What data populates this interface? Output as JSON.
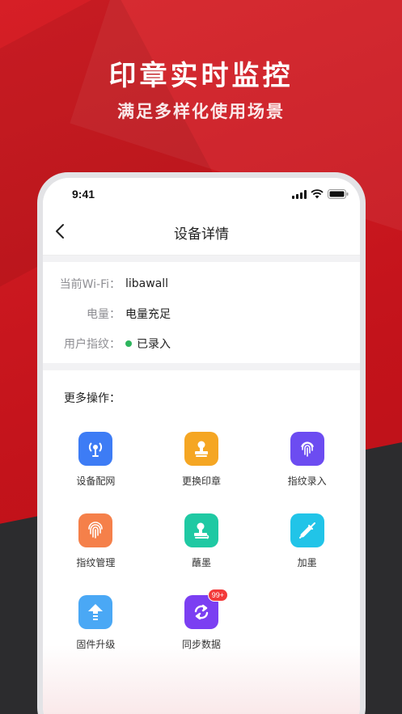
{
  "promo": {
    "headline": "印章实时监控",
    "subline": "满足多样化使用场景"
  },
  "statusbar": {
    "time": "9:41",
    "icons": [
      "signal-icon",
      "wifi-icon",
      "battery-icon"
    ]
  },
  "navbar": {
    "back_icon": "chevron-left-icon",
    "title": "设备详情"
  },
  "info": {
    "rows": [
      {
        "label": "当前Wi-Fi：",
        "value": "libawall"
      },
      {
        "label": "电量：",
        "value": "电量充足"
      },
      {
        "label": "用户指纹：",
        "value": "已录入",
        "status_color": "#2db55d"
      }
    ]
  },
  "operations": {
    "title": "更多操作：",
    "items": [
      {
        "label": "设备配网",
        "icon": "network-icon",
        "color": "#3d7cf5"
      },
      {
        "label": "更换印章",
        "icon": "stamp-icon",
        "color": "#f5a623"
      },
      {
        "label": "指纹录入",
        "icon": "fingerprint-icon",
        "color": "#6c4cf1"
      },
      {
        "label": "指纹管理",
        "icon": "fingerprint-manage-icon",
        "color": "#f5804a"
      },
      {
        "label": "蘸墨",
        "icon": "ink-stamp-icon",
        "color": "#1fc9a3"
      },
      {
        "label": "加墨",
        "icon": "syringe-icon",
        "color": "#21c4e8"
      },
      {
        "label": "固件升级",
        "icon": "upgrade-icon",
        "color": "#4aa8f5"
      },
      {
        "label": "同步数据",
        "icon": "sync-icon",
        "color": "#7b3ff2",
        "badge": "99+"
      }
    ]
  }
}
